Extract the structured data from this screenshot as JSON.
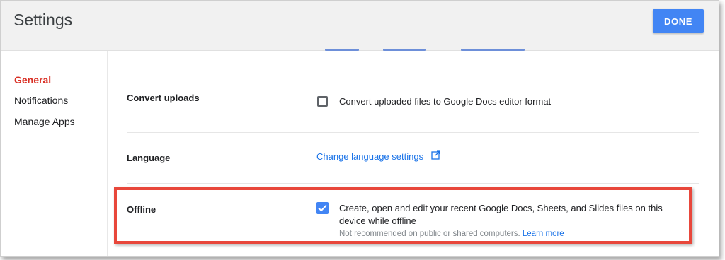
{
  "header": {
    "title": "Settings",
    "done_label": "DONE"
  },
  "sidebar": {
    "items": [
      {
        "label": "General",
        "active": true
      },
      {
        "label": "Notifications",
        "active": false
      },
      {
        "label": "Manage Apps",
        "active": false
      }
    ]
  },
  "settings": {
    "convert_uploads": {
      "label": "Convert uploads",
      "option_text": "Convert uploaded files to Google Docs editor format",
      "checked": false
    },
    "language": {
      "label": "Language",
      "link_text": "Change language settings",
      "icon": "open-in-new-icon"
    },
    "offline": {
      "label": "Offline",
      "option_line1": "Create, open and edit your recent Google Docs, Sheets, and Slides files on this",
      "option_line2": "device while offline",
      "note": "Not recommended on public or shared computers.",
      "learn_more": "Learn more",
      "checked": true
    }
  },
  "colors": {
    "accent": "#4285f4",
    "active_nav": "#d93025",
    "highlight_box": "#e8473b"
  }
}
